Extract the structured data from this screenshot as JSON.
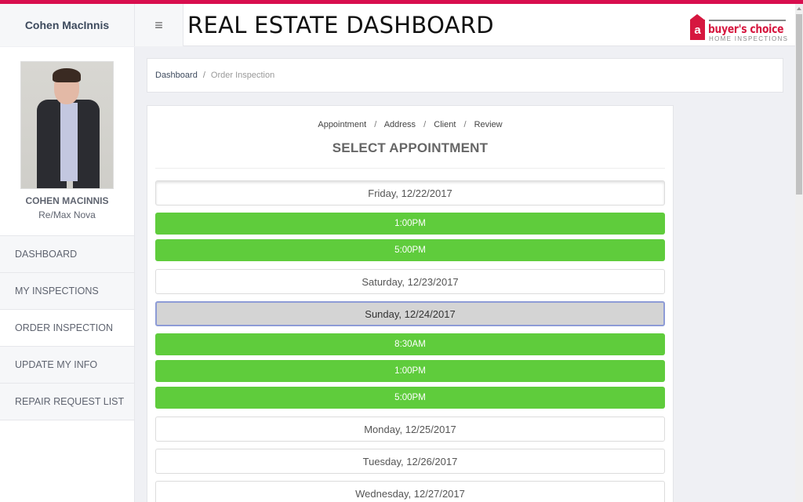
{
  "header": {
    "user_name": "Cohen MacInnis",
    "menu_icon": "hamburger-icon",
    "title": "REAL ESTATE DASHBOARD",
    "logo": {
      "mark": "a",
      "brand": "buyer's choice",
      "subtitle": "HOME INSPECTIONS"
    }
  },
  "sidebar": {
    "profile": {
      "name": "COHEN MACINNIS",
      "organization": "Re/Max Nova"
    },
    "items": [
      {
        "label": "DASHBOARD",
        "active": false
      },
      {
        "label": "MY INSPECTIONS",
        "active": false
      },
      {
        "label": "ORDER INSPECTION",
        "active": true
      },
      {
        "label": "UPDATE MY INFO",
        "active": false
      },
      {
        "label": "REPAIR REQUEST LIST",
        "active": false
      }
    ]
  },
  "breadcrumb": {
    "items": [
      "Dashboard",
      "Order Inspection"
    ],
    "separator": "/"
  },
  "wizard": {
    "steps": [
      "Appointment",
      "Address",
      "Client",
      "Review"
    ],
    "separator": "/",
    "title": "SELECT APPOINTMENT",
    "days": [
      {
        "label": "Friday, 12/22/2017",
        "selected": false,
        "slots": [
          "1:00PM",
          "5:00PM"
        ]
      },
      {
        "label": "Saturday, 12/23/2017",
        "selected": false,
        "slots": []
      },
      {
        "label": "Sunday, 12/24/2017",
        "selected": true,
        "slots": [
          "8:30AM",
          "1:00PM",
          "5:00PM"
        ]
      },
      {
        "label": "Monday, 12/25/2017",
        "selected": false,
        "slots": []
      },
      {
        "label": "Tuesday, 12/26/2017",
        "selected": false,
        "slots": []
      },
      {
        "label": "Wednesday, 12/27/2017",
        "selected": false,
        "slots": []
      }
    ]
  },
  "colors": {
    "accent_bar": "#d80e4e",
    "slot_green": "#5fcc3c",
    "selected_day_border": "#8d9bd6",
    "logo_red": "#d6173f"
  }
}
